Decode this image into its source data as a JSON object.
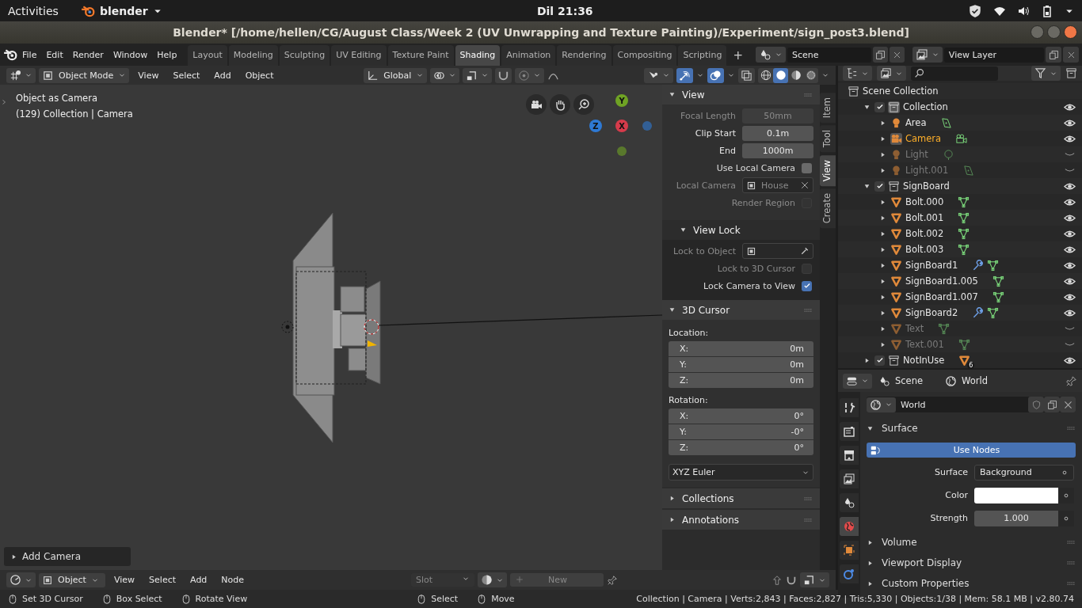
{
  "system_bar": {
    "activities": "Activities",
    "app": "blender",
    "clock": "Dil 21:36"
  },
  "window": {
    "title": "Blender* [/home/hellen/CG/August Class/Week 2 (UV Unwrapping and Texture Painting)/Experiment/sign_post3.blend]"
  },
  "menu": [
    "File",
    "Edit",
    "Render",
    "Window",
    "Help"
  ],
  "workspaces": [
    {
      "label": "Layout",
      "selected": false
    },
    {
      "label": "Modeling",
      "selected": false
    },
    {
      "label": "Sculpting",
      "selected": false
    },
    {
      "label": "UV Editing",
      "selected": false
    },
    {
      "label": "Texture Paint",
      "selected": false
    },
    {
      "label": "Shading",
      "selected": true
    },
    {
      "label": "Animation",
      "selected": false
    },
    {
      "label": "Rendering",
      "selected": false
    },
    {
      "label": "Compositing",
      "selected": false
    },
    {
      "label": "Scripting",
      "selected": false
    }
  ],
  "add_workspace": "+",
  "scene": "Scene",
  "view_layer": "View Layer",
  "viewport_header": {
    "mode": "Object Mode",
    "menus": [
      "View",
      "Select",
      "Add",
      "Object"
    ],
    "orientation": "Global",
    "toggles": [
      {
        "kind": "gizmo",
        "on": true
      },
      {
        "kind": "overlay",
        "on": true
      },
      {
        "kind": "xray",
        "on": false
      }
    ],
    "shading": [
      {
        "kind": "wireframe",
        "selected": false
      },
      {
        "kind": "solid",
        "selected": true
      },
      {
        "kind": "material",
        "selected": false
      },
      {
        "kind": "rendered",
        "selected": false
      }
    ]
  },
  "viewport": {
    "info": [
      "Object as Camera",
      "(129) Collection | Camera"
    ],
    "axes": [
      {
        "label": "Y",
        "color": "#6fa324"
      },
      {
        "label": "Z",
        "color": "#2e79d4"
      },
      {
        "label": "X",
        "color": "#d63b4b"
      }
    ],
    "last_operator": "Add Camera"
  },
  "sidebar_tabs": [
    {
      "label": "Item",
      "selected": false
    },
    {
      "label": "Tool",
      "selected": false
    },
    {
      "label": "View",
      "selected": true
    },
    {
      "label": "Create",
      "selected": false
    }
  ],
  "view_panel": {
    "title": "View",
    "expanded": true,
    "rows": [
      {
        "kind": "number",
        "label": "Focal Length",
        "value": "50mm",
        "disabled": true
      },
      {
        "kind": "number",
        "label": "Clip Start",
        "value": "0.1m",
        "disabled": false
      },
      {
        "kind": "number",
        "label": "End",
        "value": "1000m",
        "disabled": false
      },
      {
        "kind": "check",
        "label": "Use Local Camera",
        "checked": false,
        "disabled": false
      },
      {
        "kind": "object",
        "label": "Local Camera",
        "value": "House",
        "disabled": true
      },
      {
        "kind": "check",
        "label": "Render Region",
        "checked": false,
        "disabled": true
      }
    ]
  },
  "view_lock": {
    "title": "View Lock",
    "expanded": true,
    "rows": [
      {
        "kind": "picker",
        "label": "Lock to Object",
        "disabled": true
      },
      {
        "kind": "check",
        "label": "Lock to 3D Cursor",
        "checked": false,
        "disabled": true
      },
      {
        "kind": "check",
        "label": "Lock Camera to View",
        "checked": true,
        "disabled": false
      }
    ]
  },
  "cursor_panel": {
    "title": "3D Cursor",
    "expanded": true,
    "groups": [
      {
        "label": "Location:",
        "fields": [
          {
            "axis": "X:",
            "value": "0m"
          },
          {
            "axis": "Y:",
            "value": "0m"
          },
          {
            "axis": "Z:",
            "value": "0m"
          }
        ]
      },
      {
        "label": "Rotation:",
        "fields": [
          {
            "axis": "X:",
            "value": "0°"
          },
          {
            "axis": "Y:",
            "value": "-0°"
          },
          {
            "axis": "Z:",
            "value": "0°"
          }
        ]
      }
    ],
    "rotation_mode": "XYZ Euler"
  },
  "more_panels": [
    {
      "title": "Collections",
      "expanded": false
    },
    {
      "title": "Annotations",
      "expanded": false
    }
  ],
  "outliner": {
    "root": "Scene Collection",
    "items": [
      {
        "name": "Collection",
        "kind": "collection",
        "checked": true,
        "expanded": true,
        "visible": true,
        "active": true,
        "children": [
          {
            "name": "Area",
            "kind": "light",
            "expanded": false,
            "visible": true,
            "active": false,
            "data": [
              {
                "kind": "light_area"
              }
            ]
          },
          {
            "name": "Camera",
            "kind": "camera",
            "expanded": false,
            "visible": true,
            "active": true,
            "data": [
              {
                "kind": "camera"
              }
            ]
          },
          {
            "name": "Light",
            "kind": "light",
            "expanded": false,
            "visible": false,
            "active": false,
            "data": [
              {
                "kind": "light_point"
              }
            ]
          },
          {
            "name": "Light.001",
            "kind": "light",
            "expanded": false,
            "visible": false,
            "active": false,
            "data": [
              {
                "kind": "light_area"
              }
            ]
          }
        ]
      },
      {
        "name": "SignBoard",
        "kind": "collection",
        "checked": true,
        "expanded": true,
        "visible": true,
        "active": false,
        "children": [
          {
            "name": "Bolt.000",
            "kind": "mesh",
            "expanded": false,
            "visible": true,
            "active": false,
            "data": [
              {
                "kind": "mesh"
              }
            ]
          },
          {
            "name": "Bolt.001",
            "kind": "mesh",
            "expanded": false,
            "visible": true,
            "active": false,
            "data": [
              {
                "kind": "mesh"
              }
            ]
          },
          {
            "name": "Bolt.002",
            "kind": "mesh",
            "expanded": false,
            "visible": true,
            "active": false,
            "data": [
              {
                "kind": "mesh"
              }
            ]
          },
          {
            "name": "Bolt.003",
            "kind": "mesh",
            "expanded": false,
            "visible": true,
            "active": false,
            "data": [
              {
                "kind": "mesh"
              }
            ]
          },
          {
            "name": "SignBoard1",
            "kind": "mesh",
            "expanded": false,
            "visible": true,
            "active": false,
            "data": [
              {
                "kind": "modifier"
              },
              {
                "kind": "mesh"
              }
            ]
          },
          {
            "name": "SignBoard1.005",
            "kind": "mesh",
            "expanded": false,
            "visible": true,
            "active": false,
            "data": [
              {
                "kind": "mesh"
              }
            ]
          },
          {
            "name": "SignBoard1.007",
            "kind": "mesh",
            "expanded": false,
            "visible": true,
            "active": false,
            "data": [
              {
                "kind": "mesh"
              }
            ]
          },
          {
            "name": "SignBoard2",
            "kind": "mesh",
            "expanded": false,
            "visible": true,
            "active": false,
            "data": [
              {
                "kind": "modifier"
              },
              {
                "kind": "mesh"
              }
            ]
          },
          {
            "name": "Text",
            "kind": "mesh",
            "expanded": false,
            "visible": false,
            "active": false,
            "data": [
              {
                "kind": "mesh"
              }
            ]
          },
          {
            "name": "Text.001",
            "kind": "mesh",
            "expanded": false,
            "visible": false,
            "active": false,
            "data": [
              {
                "kind": "mesh"
              }
            ]
          }
        ]
      },
      {
        "name": "NotInUse",
        "kind": "collection",
        "checked": true,
        "expanded": false,
        "visible": true,
        "active": false,
        "count": "6"
      }
    ]
  },
  "properties": {
    "breadcrumb": [
      "Scene",
      "World"
    ],
    "tabs": [
      {
        "kind": "tool",
        "selected": false
      },
      {
        "kind": "render",
        "selected": false
      },
      {
        "kind": "output",
        "selected": false
      },
      {
        "kind": "view_layer",
        "selected": false
      },
      {
        "kind": "scene",
        "selected": false
      },
      {
        "kind": "world",
        "selected": true
      },
      {
        "kind": "object",
        "selected": false
      },
      {
        "kind": "constraint",
        "selected": false
      }
    ],
    "datablock": "World",
    "surface_title": "Surface",
    "use_nodes": "Use Nodes",
    "rows": [
      {
        "kind": "link",
        "label": "Surface",
        "value": "Background"
      },
      {
        "kind": "color",
        "label": "Color",
        "color": "#ffffff"
      },
      {
        "kind": "number",
        "label": "Strength",
        "value": "1.000"
      }
    ],
    "collapsed": [
      {
        "title": "Volume",
        "expanded": false
      },
      {
        "title": "Viewport Display",
        "expanded": false
      },
      {
        "title": "Custom Properties",
        "expanded": false
      }
    ]
  },
  "shader_header": {
    "object": "Object",
    "menus": [
      "View",
      "Select",
      "Add",
      "Node"
    ],
    "slot": "Slot",
    "new_button": "New"
  },
  "status_bar": {
    "hints": [
      "Set 3D Cursor",
      "Box Select",
      "Rotate View",
      "Select",
      "Move"
    ],
    "stats": "Collection | Camera | Verts:2,843 | Faces:2,827 | Tris:5,330 | Objects:1/38 | Mem: 58.1 MB | v2.80.74"
  }
}
